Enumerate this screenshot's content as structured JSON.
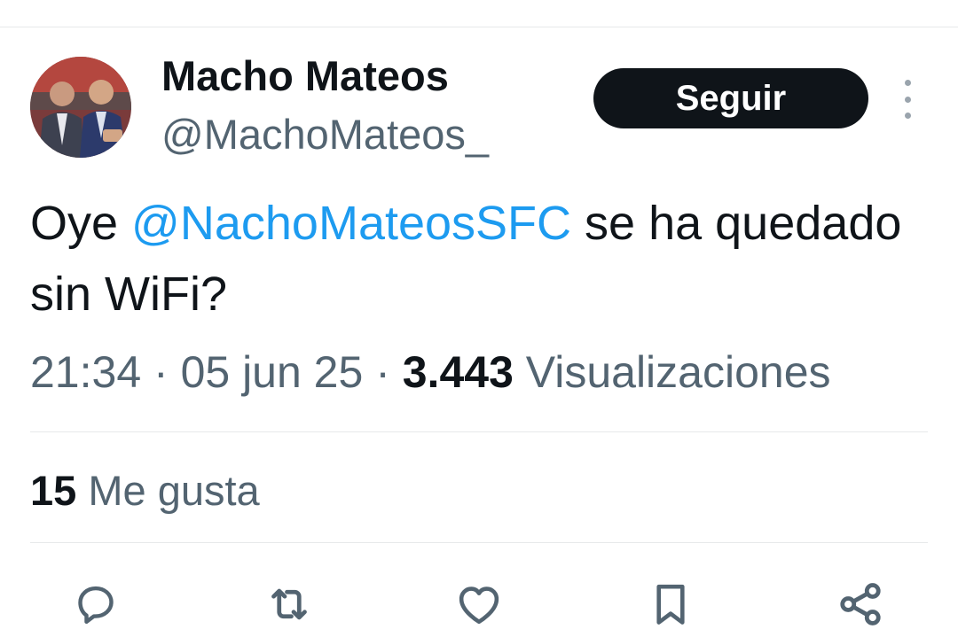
{
  "author": {
    "display_name": "Macho Mateos",
    "handle": "@MachoMateos_"
  },
  "header": {
    "follow_label": "Seguir",
    "more_icon": "more-vertical-icon"
  },
  "tweet": {
    "text_before": "Oye ",
    "mention": "@NachoMateosSFC",
    "text_after": " se ha quedado sin WiFi?",
    "time": "21:34",
    "separator": " · ",
    "date": "05 jun 25",
    "views_count": "3.443",
    "views_label": "Visualizaciones"
  },
  "stats": {
    "likes_count": "15",
    "likes_label": "Me gusta"
  },
  "actions": [
    {
      "icon": "reply-icon"
    },
    {
      "icon": "retweet-icon"
    },
    {
      "icon": "like-icon"
    },
    {
      "icon": "bookmark-icon"
    },
    {
      "icon": "share-icon"
    }
  ],
  "colors": {
    "text": "#0f1419",
    "secondary": "#536471",
    "mention": "#1d9bf0",
    "button_bg": "#0f1419",
    "divider": "#e7e9ea"
  }
}
